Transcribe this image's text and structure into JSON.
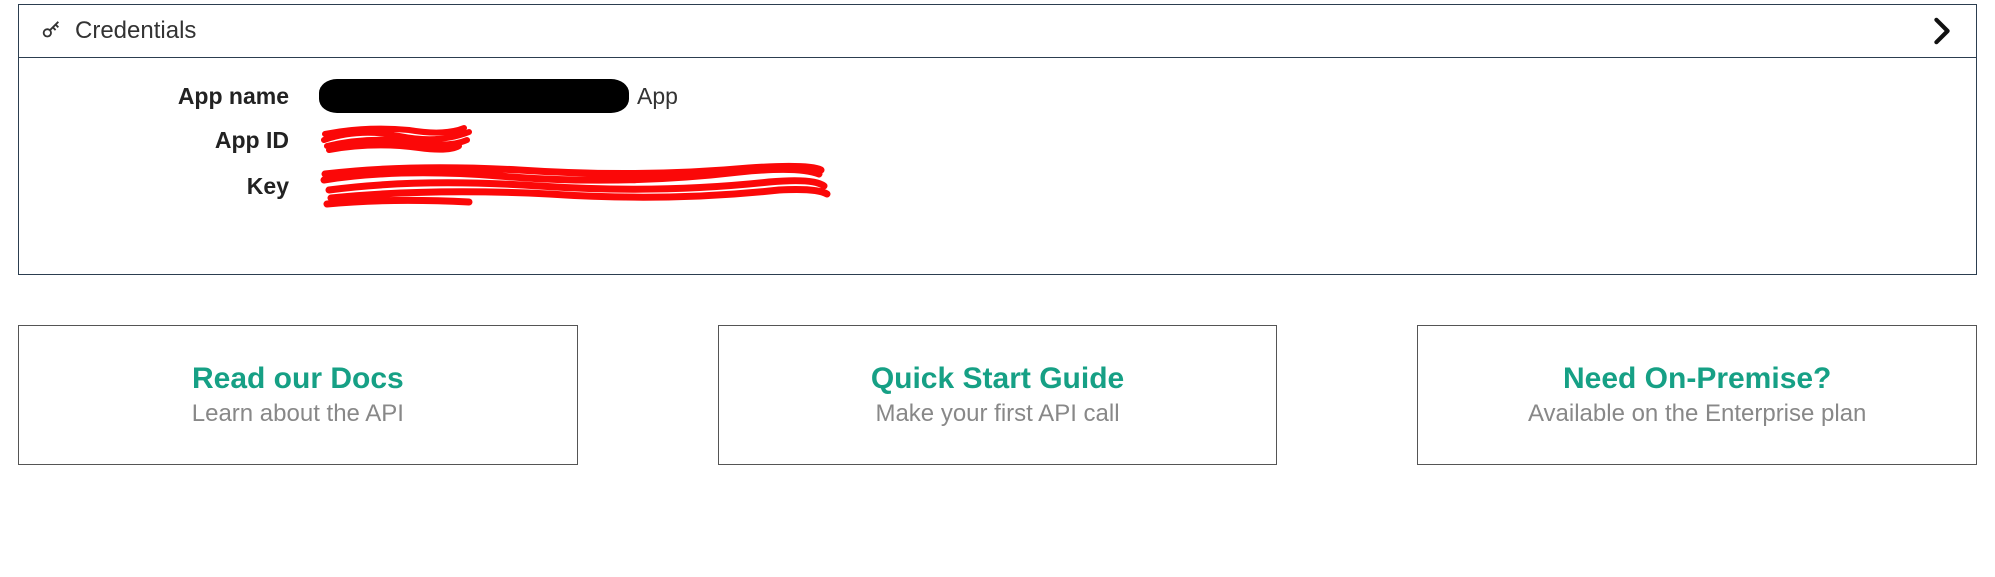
{
  "credentials": {
    "header_title": "Credentials",
    "fields": {
      "app_name_label": "App name",
      "app_name_value_suffix": "App",
      "app_id_label": "App ID",
      "key_label": "Key"
    }
  },
  "cards": [
    {
      "title": "Read our Docs",
      "subtitle": "Learn about the API"
    },
    {
      "title": "Quick Start Guide",
      "subtitle": "Make your first API call"
    },
    {
      "title": "Need On-Premise?",
      "subtitle": "Available on the Enterprise plan"
    }
  ]
}
